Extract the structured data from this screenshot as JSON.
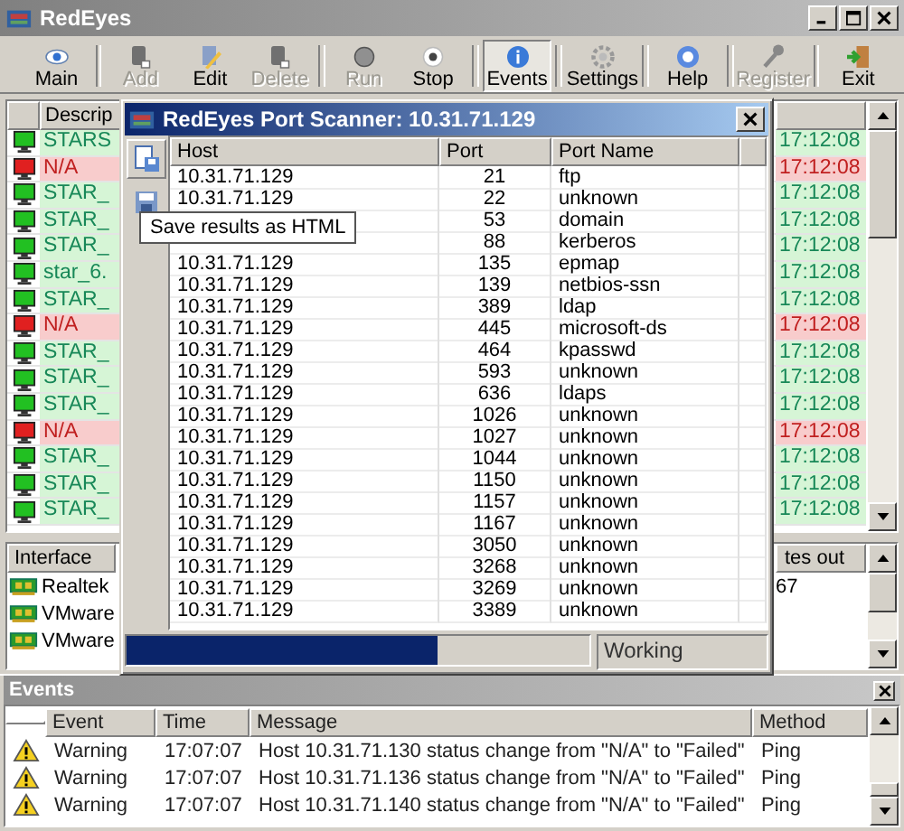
{
  "window": {
    "title": "RedEyes"
  },
  "toolbar": [
    {
      "label": "Main",
      "kind": "eye",
      "disabled": false,
      "selected": false
    },
    {
      "label": "Add",
      "kind": "doc",
      "disabled": true,
      "selected": false
    },
    {
      "label": "Edit",
      "kind": "pencil",
      "disabled": false,
      "selected": false
    },
    {
      "label": "Delete",
      "kind": "doc",
      "disabled": true,
      "selected": false
    },
    {
      "label": "Run",
      "kind": "run",
      "disabled": true,
      "selected": false
    },
    {
      "label": "Stop",
      "kind": "stop",
      "disabled": false,
      "selected": false
    },
    {
      "label": "Events",
      "kind": "info",
      "disabled": false,
      "selected": true
    },
    {
      "label": "Settings",
      "kind": "gear",
      "disabled": false,
      "selected": false
    },
    {
      "label": "Help",
      "kind": "help",
      "disabled": false,
      "selected": false
    },
    {
      "label": "Register",
      "kind": "key",
      "disabled": true,
      "selected": false
    },
    {
      "label": "Exit",
      "kind": "exit",
      "disabled": false,
      "selected": false
    }
  ],
  "hosts": {
    "column": "Descrip",
    "rows": [
      {
        "failed": false,
        "description": "STARS",
        "time": "17:12:08"
      },
      {
        "failed": true,
        "description": "N/A",
        "time": "17:12:08"
      },
      {
        "failed": false,
        "description": "STAR_",
        "time": "17:12:08"
      },
      {
        "failed": false,
        "description": "STAR_",
        "time": "17:12:08"
      },
      {
        "failed": false,
        "description": "STAR_",
        "time": "17:12:08"
      },
      {
        "failed": false,
        "description": "star_6.",
        "time": "17:12:08"
      },
      {
        "failed": false,
        "description": "STAR_",
        "time": "17:12:08"
      },
      {
        "failed": true,
        "description": "N/A",
        "time": "17:12:08"
      },
      {
        "failed": false,
        "description": "STAR_",
        "time": "17:12:08"
      },
      {
        "failed": false,
        "description": "STAR_",
        "time": "17:12:08"
      },
      {
        "failed": false,
        "description": "STAR_",
        "time": "17:12:08"
      },
      {
        "failed": true,
        "description": "N/A",
        "time": "17:12:08"
      },
      {
        "failed": false,
        "description": "STAR_",
        "time": "17:12:08"
      },
      {
        "failed": false,
        "description": "STAR_",
        "time": "17:12:08"
      },
      {
        "failed": false,
        "description": "STAR_",
        "time": "17:12:08"
      }
    ]
  },
  "interfaces": {
    "columns": [
      "Interface",
      "tes out"
    ],
    "rows": [
      {
        "name": "Realtek",
        "bytes_out": "67"
      },
      {
        "name": "VMware"
      },
      {
        "name": "VMware"
      }
    ]
  },
  "events": {
    "title": "Events",
    "columns": [
      "Event",
      "Time",
      "Message",
      "Method"
    ],
    "rows": [
      {
        "event": "Warning",
        "time": "17:07:07",
        "message": "Host 10.31.71.130 status change from \"N/A\" to \"Failed\"",
        "method": "Ping"
      },
      {
        "event": "Warning",
        "time": "17:07:07",
        "message": "Host 10.31.71.136 status change from \"N/A\" to \"Failed\"",
        "method": "Ping"
      },
      {
        "event": "Warning",
        "time": "17:07:07",
        "message": "Host 10.31.71.140 status change from \"N/A\" to \"Failed\"",
        "method": "Ping"
      }
    ]
  },
  "scanner": {
    "title": "RedEyes Port Scanner: 10.31.71.129",
    "tooltip": "Save results as HTML",
    "columns": [
      "Host",
      "Port",
      "Port Name"
    ],
    "rows": [
      {
        "host": "10.31.71.129",
        "port": "21",
        "name": "ftp"
      },
      {
        "host": "10.31.71.129",
        "port": "22",
        "name": "unknown"
      },
      {
        "port": "53",
        "name": "domain"
      },
      {
        "port": "88",
        "name": "kerberos"
      },
      {
        "host": "10.31.71.129",
        "port": "135",
        "name": "epmap"
      },
      {
        "host": "10.31.71.129",
        "port": "139",
        "name": "netbios-ssn"
      },
      {
        "host": "10.31.71.129",
        "port": "389",
        "name": "ldap"
      },
      {
        "host": "10.31.71.129",
        "port": "445",
        "name": "microsoft-ds"
      },
      {
        "host": "10.31.71.129",
        "port": "464",
        "name": "kpasswd"
      },
      {
        "host": "10.31.71.129",
        "port": "593",
        "name": "unknown"
      },
      {
        "host": "10.31.71.129",
        "port": "636",
        "name": "ldaps"
      },
      {
        "host": "10.31.71.129",
        "port": "1026",
        "name": "unknown"
      },
      {
        "host": "10.31.71.129",
        "port": "1027",
        "name": "unknown"
      },
      {
        "host": "10.31.71.129",
        "port": "1044",
        "name": "unknown"
      },
      {
        "host": "10.31.71.129",
        "port": "1150",
        "name": "unknown"
      },
      {
        "host": "10.31.71.129",
        "port": "1157",
        "name": "unknown"
      },
      {
        "host": "10.31.71.129",
        "port": "1167",
        "name": "unknown"
      },
      {
        "host": "10.31.71.129",
        "port": "3050",
        "name": "unknown"
      },
      {
        "host": "10.31.71.129",
        "port": "3268",
        "name": "unknown"
      },
      {
        "host": "10.31.71.129",
        "port": "3269",
        "name": "unknown"
      },
      {
        "host": "10.31.71.129",
        "port": "3389",
        "name": "unknown"
      }
    ],
    "progress": {
      "level": 0.67
    },
    "status": "Working"
  }
}
